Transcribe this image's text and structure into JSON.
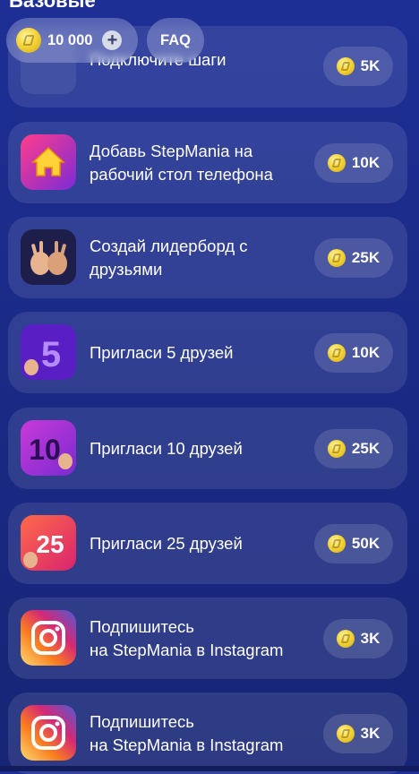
{
  "section": {
    "title": "Базовые"
  },
  "header": {
    "balance": "10 000",
    "add_icon": "plus-icon",
    "faq_label": "FAQ"
  },
  "colors": {
    "background": "#1d2f95",
    "card": "rgba(255,255,255,0.10)",
    "coin": "#f3d53a"
  },
  "tasks": [
    {
      "title_line1": "Подключите шаги",
      "title_line2": "",
      "reward": "5K",
      "icon": "steps-icon"
    },
    {
      "title_line1": "Добавь StepMania на",
      "title_line2": "рабочий стол телефона",
      "reward": "10K",
      "icon": "home-icon"
    },
    {
      "title_line1": "Создай лидерборд с",
      "title_line2": "друзьями",
      "reward": "25K",
      "icon": "hands-icon"
    },
    {
      "title_line1": "Пригласи 5 друзей",
      "title_line2": "",
      "reward": "10K",
      "icon": "invite-5-icon"
    },
    {
      "title_line1": "Пригласи 10 друзей",
      "title_line2": "",
      "reward": "25K",
      "icon": "invite-10-icon"
    },
    {
      "title_line1": "Пригласи 25 друзей",
      "title_line2": "",
      "reward": "50K",
      "icon": "invite-25-icon"
    },
    {
      "title_line1": "Подпишитесь",
      "title_line2": "на StepMania в Instagram",
      "reward": "3K",
      "icon": "instagram-icon"
    },
    {
      "title_line1": "Подпишитесь",
      "title_line2": "на StepMania в Instagram",
      "reward": "3K",
      "icon": "instagram-icon"
    }
  ],
  "icon_numbers": {
    "invite5": "5",
    "invite10": "10",
    "invite25": "25"
  }
}
